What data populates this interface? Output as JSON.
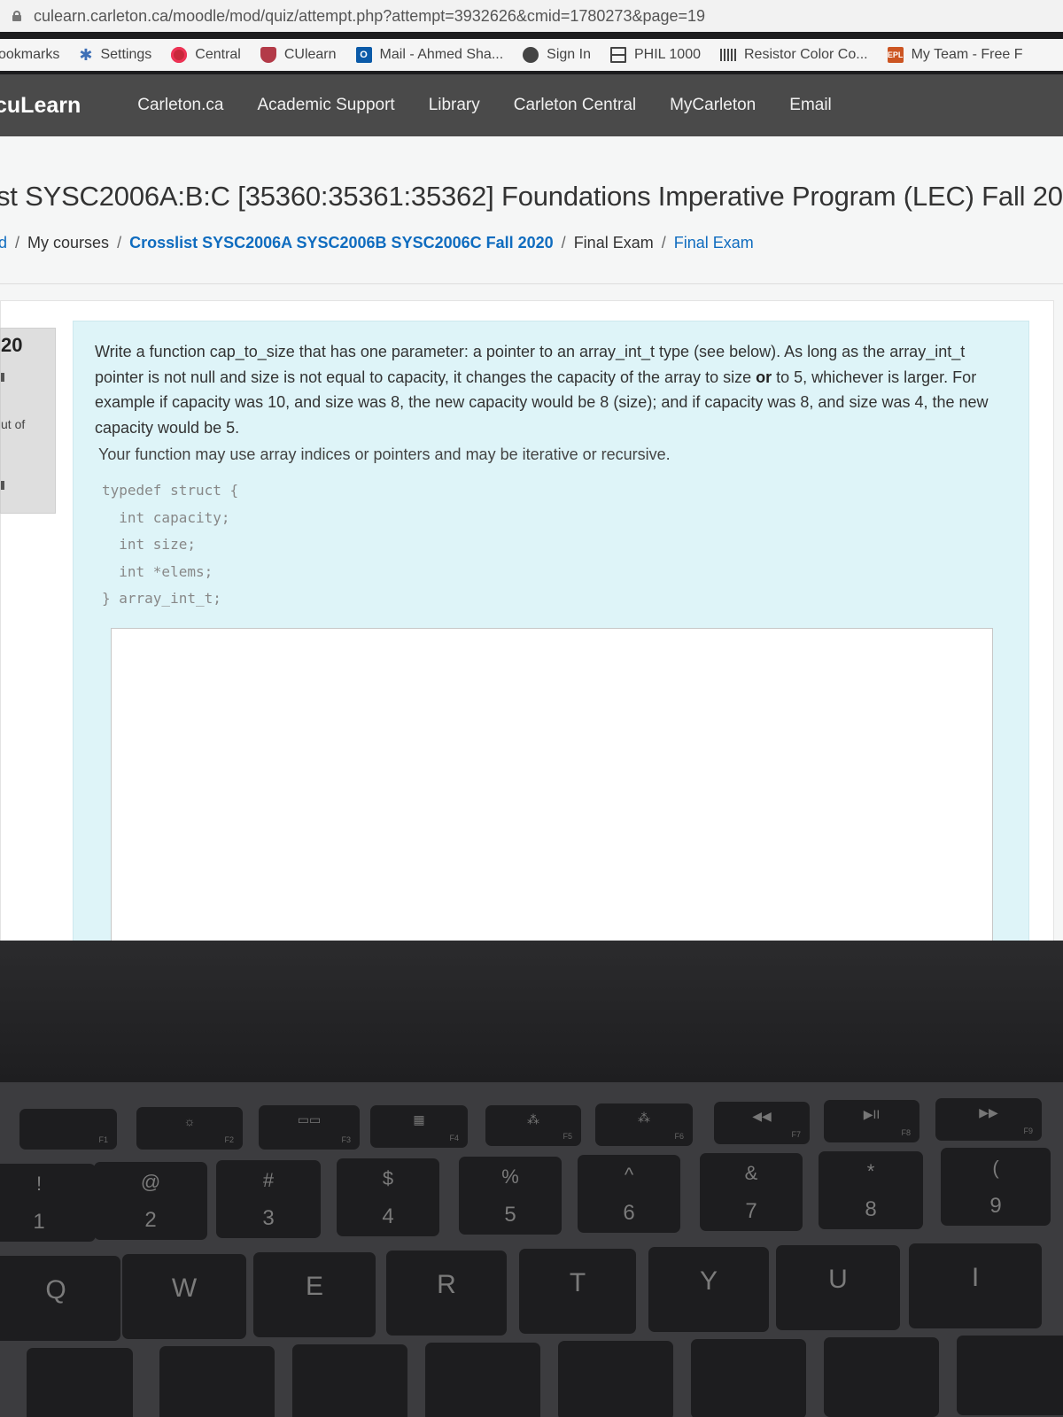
{
  "browser": {
    "url": "culearn.carleton.ca/moodle/mod/quiz/attempt.php?attempt=3932626&cmid=1780273&page=19",
    "bookmarks": [
      {
        "label": "ookmarks",
        "icon": "none"
      },
      {
        "label": "Settings",
        "icon": "gear-icon"
      },
      {
        "label": "Central",
        "icon": "central-icon"
      },
      {
        "label": "CUlearn",
        "icon": "culearn-icon"
      },
      {
        "label": "Mail - Ahmed Sha...",
        "icon": "outlook-icon"
      },
      {
        "label": "Sign In",
        "icon": "sign-in-icon"
      },
      {
        "label": "PHIL 1000",
        "icon": "grid-icon"
      },
      {
        "label": "Resistor Color Co...",
        "icon": "resistor-icon"
      },
      {
        "label": "My Team - Free F",
        "icon": "epl-icon"
      }
    ]
  },
  "site_nav": {
    "brand": "cuLearn",
    "links": [
      "Carleton.ca",
      "Academic Support",
      "Library",
      "Carleton Central",
      "MyCarleton",
      "Email"
    ]
  },
  "page": {
    "course_title": "st SYSC2006A:B:C [35360:35361:35362] Foundations Imperative Program (LEC) Fall 20",
    "breadcrumb": {
      "first": "d",
      "items": [
        "My courses",
        "Crosslist SYSC2006A SYSC2006B SYSC2006C Fall 2020",
        "Final Exam",
        "Final Exam"
      ]
    }
  },
  "question": {
    "number": "20",
    "out_of": "ut of",
    "text_part1": "Write a function cap_to_size that has one parameter: a pointer to an array_int_t type (see below).  As long as the array_int_t pointer is not null and size is not equal to capacity, it changes the capacity of the array to size ",
    "text_bold": "or",
    "text_part2": " to 5, whichever is larger.  For example if capacity was 10, and size was 8, the new capacity would be 8 (size); and if capacity was 8, and size was 4, the new capacity would be 5.",
    "text_second": "Your function may use array indices or pointers and may be iterative or recursive.",
    "code_lines": [
      "typedef struct {",
      "  int capacity;",
      "  int size;",
      "  int *elems;",
      "} array_int_t;"
    ],
    "answer_value": ""
  },
  "keyboard": {
    "fn_row": [
      {
        "label": "F1",
        "icon": ""
      },
      {
        "label": "F2",
        "icon": "☼"
      },
      {
        "label": "F3",
        "icon": "▭▭"
      },
      {
        "label": "F4",
        "icon": "▦"
      },
      {
        "label": "F5",
        "icon": "⁂"
      },
      {
        "label": "F6",
        "icon": "⁂"
      },
      {
        "label": "F7",
        "icon": "◀◀"
      },
      {
        "label": "F8",
        "icon": "▶II"
      },
      {
        "label": "F9",
        "icon": "▶▶"
      }
    ],
    "number_row": [
      {
        "up": "!",
        "lo": "1"
      },
      {
        "up": "@",
        "lo": "2"
      },
      {
        "up": "#",
        "lo": "3"
      },
      {
        "up": "$",
        "lo": "4"
      },
      {
        "up": "%",
        "lo": "5"
      },
      {
        "up": "^",
        "lo": "6"
      },
      {
        "up": "&",
        "lo": "7"
      },
      {
        "up": "*",
        "lo": "8"
      },
      {
        "up": "(",
        "lo": "9"
      }
    ],
    "letter_row": [
      "Q",
      "W",
      "E",
      "R",
      "T",
      "Y",
      "U",
      "I"
    ]
  }
}
